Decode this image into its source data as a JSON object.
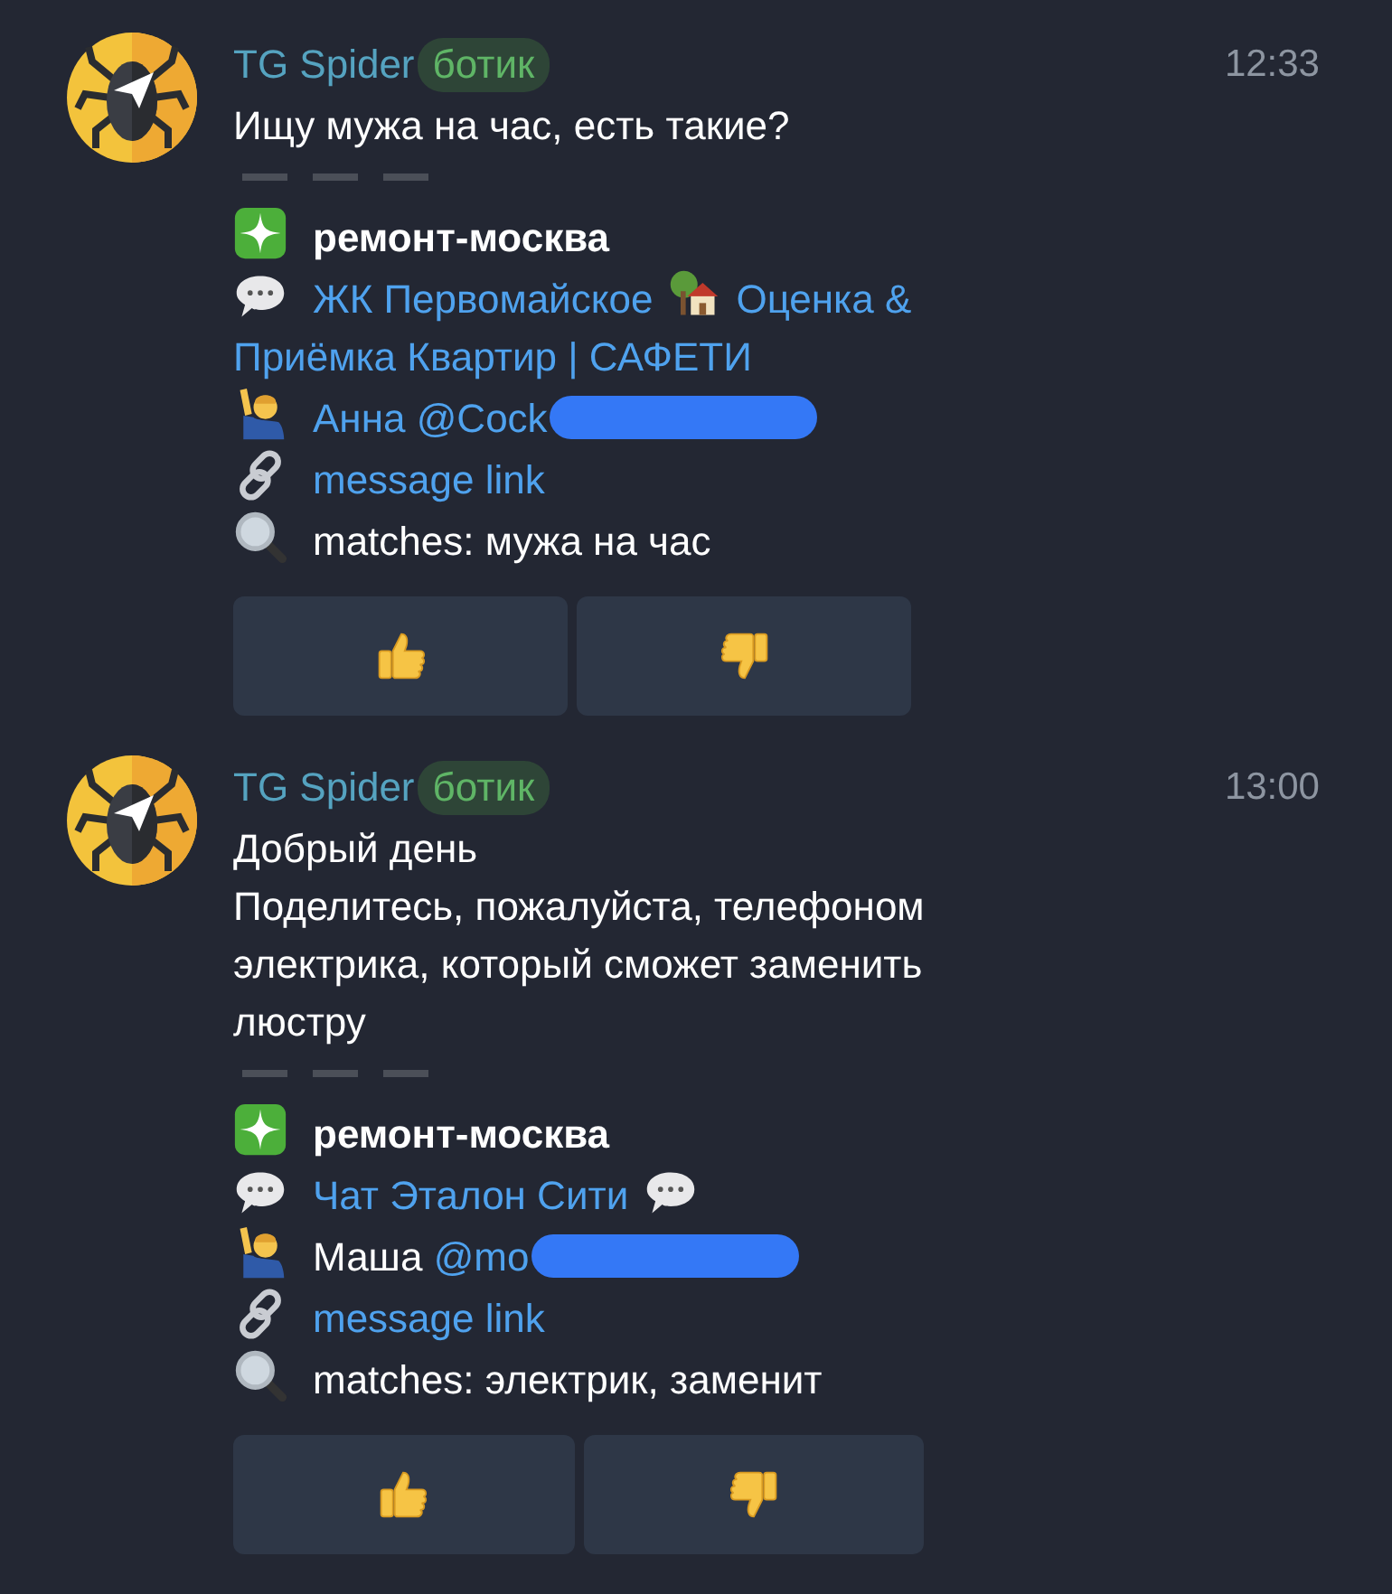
{
  "messages": [
    {
      "sender": "TG Spider",
      "badge": "ботик",
      "time": "12:33",
      "text": "Ищу мужа на час, есть такие?",
      "channel": "ремонт-москва",
      "chat": {
        "text": "ЖК Первомайское",
        "text_after": "Оценка &\nПриёмка Квартир | САФЕТИ"
      },
      "user": {
        "name": "Анна",
        "handle": "@Cock",
        "name_linked": true,
        "redacted": true
      },
      "link": "message link",
      "matches": "matches: мужа на час",
      "buttons": [
        {
          "kind": "like"
        },
        {
          "kind": "dislike"
        }
      ]
    },
    {
      "sender": "TG Spider",
      "badge": "ботик",
      "time": "13:00",
      "text": "Добрый день\nПоделитесь, пожалуйста, телефоном\nэлектрика, который сможет заменить\nлюстру",
      "channel": "ремонт-москва",
      "chat": {
        "text": "Чат Эталон Сити"
      },
      "user": {
        "name": "Маша",
        "handle": "@mo",
        "name_linked": false,
        "redacted": true
      },
      "link": "message link",
      "matches": "matches: электрик, заменит",
      "buttons": [
        {
          "kind": "like"
        },
        {
          "kind": "dislike"
        }
      ]
    }
  ]
}
